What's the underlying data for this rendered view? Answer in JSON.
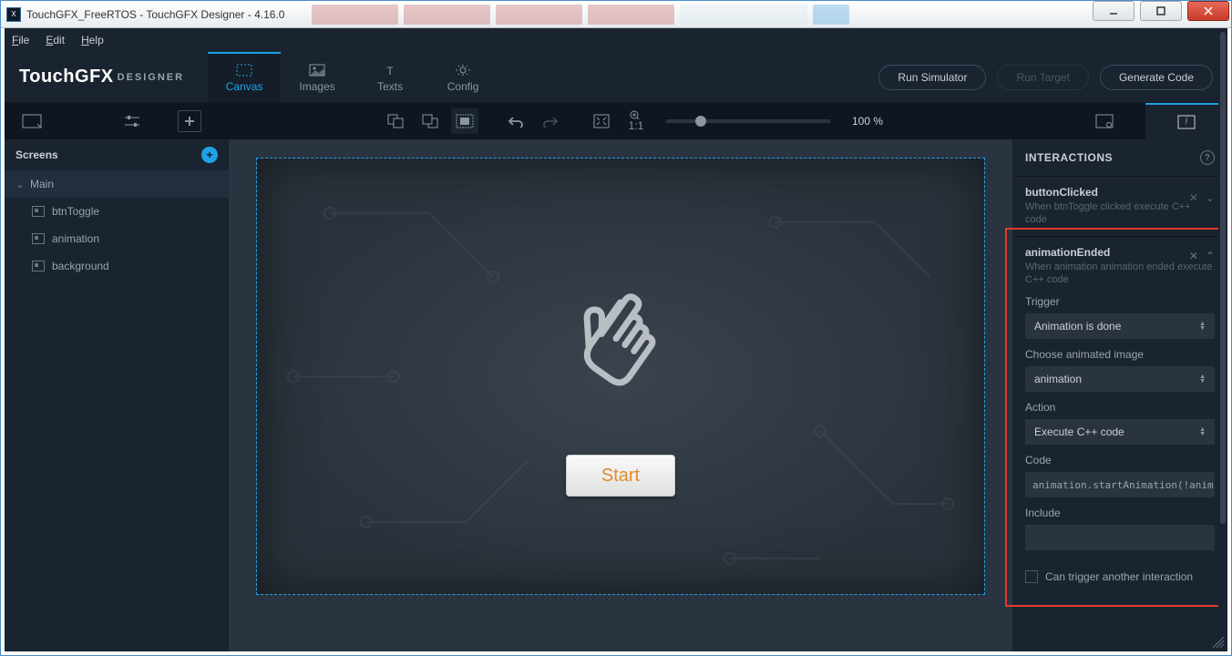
{
  "window": {
    "title": "TouchGFX_FreeRTOS - TouchGFX Designer - 4.16.0"
  },
  "menubar": {
    "file": "File",
    "edit": "Edit",
    "help": "Help"
  },
  "logo": {
    "main": "TouchGFX",
    "sub": "DESIGNER"
  },
  "main_tabs": {
    "canvas": "Canvas",
    "images": "Images",
    "texts": "Texts",
    "config": "Config"
  },
  "actions": {
    "run_sim": "Run Simulator",
    "run_target": "Run Target",
    "generate": "Generate Code"
  },
  "zoom": {
    "value": "100 %",
    "ratio": "1:1"
  },
  "screens": {
    "header": "Screens",
    "root": "Main",
    "items": [
      "btnToggle",
      "animation",
      "background"
    ]
  },
  "canvas": {
    "start_label": "Start"
  },
  "interactions": {
    "header": "INTERACTIONS",
    "items": [
      {
        "title": "buttonClicked",
        "sub": "When btnToggle clicked execute C++ code"
      },
      {
        "title": "animationEnded",
        "sub": "When animation animation ended execute C++ code"
      }
    ],
    "fields": {
      "trigger_label": "Trigger",
      "trigger_value": "Animation is done",
      "choose_label": "Choose animated image",
      "choose_value": "animation",
      "action_label": "Action",
      "action_value": "Execute C++ code",
      "code_label": "Code",
      "code_value": "animation.startAnimation(!anim",
      "include_label": "Include",
      "include_value": "",
      "cantrigger": "Can trigger another interaction"
    }
  }
}
